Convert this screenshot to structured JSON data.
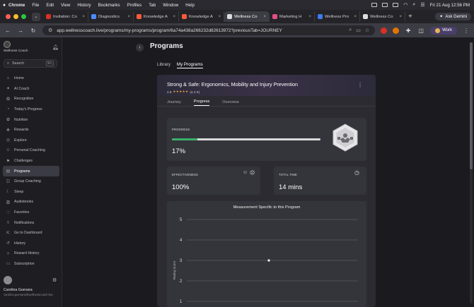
{
  "menubar": {
    "app": "Chrome",
    "items": [
      "File",
      "Edit",
      "View",
      "History",
      "Bookmarks",
      "Profiles",
      "Tab",
      "Window",
      "Help"
    ],
    "datetime": "Fri 21 Aug  12:56 PM"
  },
  "browser": {
    "tabs": [
      {
        "title": "Invitation: Co",
        "color": "#d93025"
      },
      {
        "title": "Diagnostics",
        "color": "#4a8cff"
      },
      {
        "title": "Knowledge A",
        "color": "#ff5a3c"
      },
      {
        "title": "Knowledge A",
        "color": "#ff5a3c"
      },
      {
        "title": "Wellness Co",
        "color": "#dddddd",
        "active": true
      },
      {
        "title": "Marketing H",
        "color": "#e44d83"
      },
      {
        "title": "Wellness Pro",
        "color": "#3d7bf0"
      },
      {
        "title": "Wellness Co",
        "color": "#dddddd"
      }
    ],
    "ask_gemini": "Ask Gemini",
    "url": "app.wellnesscoach.live/programs/my-programs/program/6a74a438a266232d82613972?previousTab=JOURNEY",
    "profile": "Work"
  },
  "sidebar": {
    "brand": "Wellness Coach",
    "search_label": "Search",
    "search_shortcut": "⌘K",
    "items": [
      {
        "label": "Home",
        "icon": "home-icon",
        "glyph": "⌂"
      },
      {
        "label": "AI Coach",
        "icon": "sparkle-icon",
        "glyph": "✦"
      },
      {
        "label": "Recognition",
        "icon": "award-icon",
        "glyph": "✪"
      },
      {
        "label": "Today's Progress",
        "icon": "progress-icon",
        "glyph": "◔"
      },
      {
        "label": "Nutrition",
        "icon": "nutrition-icon",
        "glyph": "✿"
      },
      {
        "label": "Rewards",
        "icon": "rewards-icon",
        "glyph": "❖"
      },
      {
        "label": "Explore",
        "icon": "explore-icon",
        "glyph": "◎"
      },
      {
        "label": "Personal Coaching",
        "icon": "coaching-icon",
        "glyph": "☺"
      },
      {
        "label": "Challenges",
        "icon": "challenges-icon",
        "glyph": "⚑"
      },
      {
        "label": "Programs",
        "icon": "programs-icon",
        "glyph": "▤",
        "active": true
      },
      {
        "label": "Group Coaching",
        "icon": "group-icon",
        "glyph": "☷"
      },
      {
        "label": "Sleep",
        "icon": "sleep-icon",
        "glyph": "☾"
      },
      {
        "label": "Audiobooks",
        "icon": "audiobooks-icon",
        "glyph": "▥"
      },
      {
        "label": "Favorites",
        "icon": "heart-icon",
        "glyph": "♡"
      },
      {
        "label": "Notifications",
        "icon": "bell-icon",
        "glyph": "◊"
      },
      {
        "label": "Go to Dashboard",
        "icon": "dashboard-icon",
        "glyph": "⇱"
      },
      {
        "label": "History",
        "icon": "history-icon",
        "glyph": "↺"
      },
      {
        "label": "Reward History",
        "icon": "reward-history-icon",
        "glyph": "✧"
      },
      {
        "label": "Subscription",
        "icon": "subscription-icon",
        "glyph": "▭"
      }
    ],
    "user": {
      "name": "Carolina Guevara",
      "email": "carolina.guevara@wellnesscoach.live"
    }
  },
  "page": {
    "title": "Programs",
    "tabs": [
      "Library",
      "My Programs"
    ],
    "active_tab": "My Programs"
  },
  "program": {
    "title": "Strong & Safe: Ergonomics, Mobility and Injury Prevention",
    "rating": "4.8",
    "stars": "★★★★★",
    "rating_count": "(4.4 K)",
    "tabs": [
      "Journey",
      "Progress",
      "Overview"
    ],
    "active_tab": "Progress",
    "progress": {
      "label": "PROGRESS",
      "value": "17%",
      "fraction": 0.17
    },
    "effectiveness": {
      "label": "EFFECTIVENESS",
      "value": "100%"
    },
    "total_time": {
      "label": "TOTAL TIME",
      "value": "14 mins"
    }
  },
  "chart_data": {
    "type": "scatter",
    "title": "Measurement Specific to this Program",
    "ylabel": "Rating Score",
    "xlabel": "",
    "ylim": [
      1,
      5
    ],
    "yticks": [
      1,
      2,
      3,
      4,
      5
    ],
    "grid": true,
    "points": [
      {
        "x": 1,
        "y": 3
      }
    ]
  },
  "colors": {
    "accent": "#3bb06a",
    "active_nav": "#3b3b44",
    "star": "#e8a23a"
  }
}
